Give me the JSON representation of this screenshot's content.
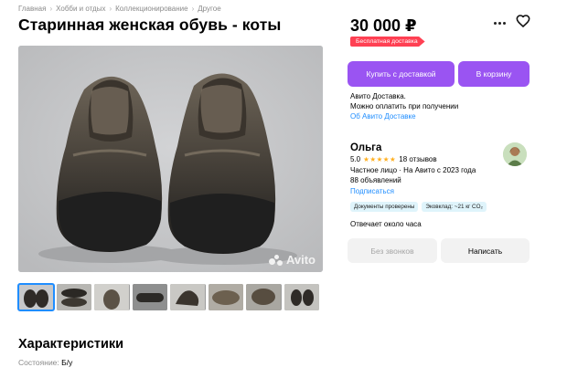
{
  "breadcrumb": [
    "Главная",
    "Хобби и отдых",
    "Коллекционирование",
    "Другое"
  ],
  "listing": {
    "title": "Старинная женская обувь - коты",
    "price": "30 000 ₽",
    "badge": "Бесплатная доставка",
    "gallery_watermark": "Avito",
    "thumbnails_count": 8
  },
  "actions": {
    "buy_with_delivery": "Купить с доставкой",
    "add_to_cart": "В корзину"
  },
  "delivery": {
    "line1": "Авито Доставка.",
    "line2": "Можно оплатить при получении",
    "link": "Об Авито Доставке"
  },
  "seller": {
    "name": "Ольга",
    "rating": "5.0",
    "stars": "★★★★★",
    "reviews": "18 отзывов",
    "since": "Частное лицо · На Авито с 2023 года",
    "listings": "88 объявлений",
    "subscribe": "Подписаться",
    "tags": [
      "Документы проверены",
      "Эковклад: ~21 кг CO₂"
    ],
    "response_time": "Отвечает около часа"
  },
  "contact": {
    "call": "Без звонков",
    "write": "Написать"
  },
  "characteristics": {
    "title": "Характеристики",
    "condition_key": "Состояние:",
    "condition_value": "Б/у"
  },
  "icons": {
    "more": "more-dots-icon",
    "favorite": "heart-icon",
    "watermark": "avito-logo-icon"
  },
  "colors": {
    "accent": "#9a54f2",
    "badge": "#ff4053",
    "link": "#1f8dff",
    "star": "#ffb021"
  }
}
